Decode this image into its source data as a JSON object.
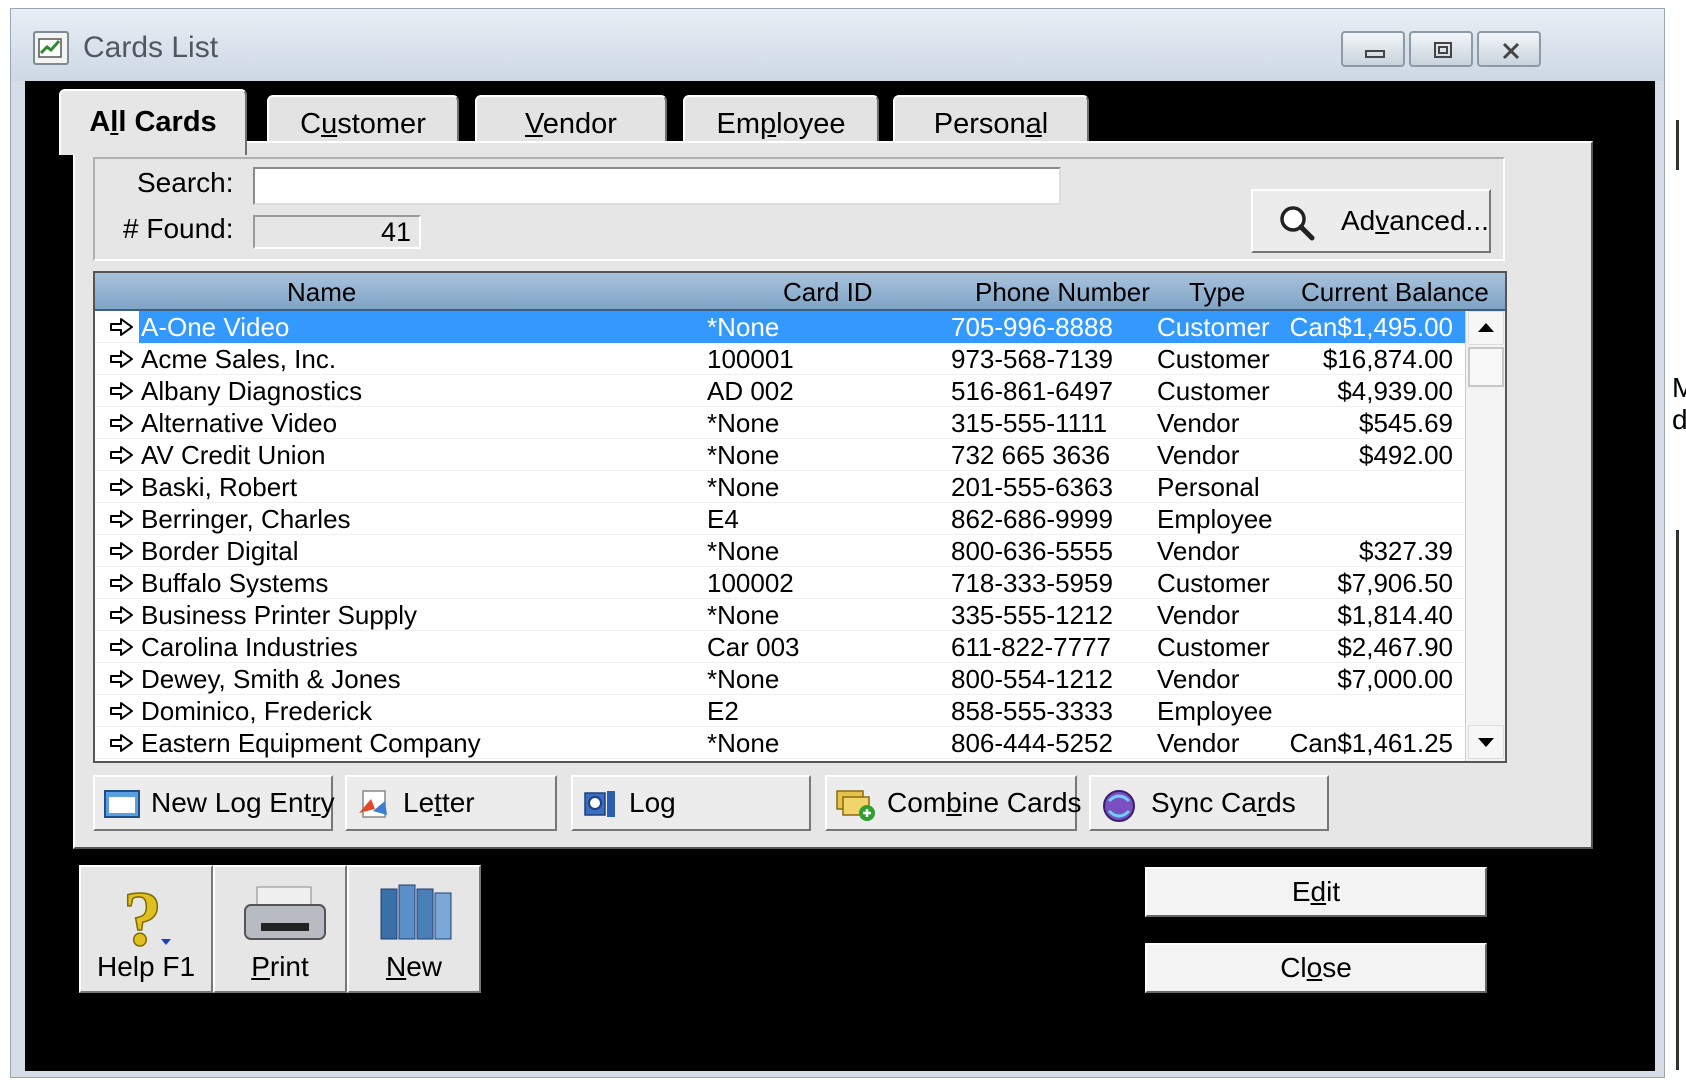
{
  "window": {
    "title": "Cards List"
  },
  "tabs": [
    {
      "label_pre": "A",
      "label_u": "l",
      "label_post": "l Cards",
      "active": true
    },
    {
      "label_pre": "C",
      "label_u": "u",
      "label_post": "stomer",
      "active": false
    },
    {
      "label_pre": "",
      "label_u": "V",
      "label_post": "endor",
      "active": false
    },
    {
      "label_pre": "Em",
      "label_u": "p",
      "label_post": "loyee",
      "active": false
    },
    {
      "label_pre": "Person",
      "label_u": "a",
      "label_post": "l",
      "active": false
    }
  ],
  "search": {
    "label": "Search:",
    "value": "",
    "found_label": "# Found:",
    "found_value": "41",
    "advanced_pre": "Ad",
    "advanced_u": "v",
    "advanced_post": "anced..."
  },
  "table": {
    "columns": [
      "Name",
      "Card ID",
      "Phone Number",
      "Type",
      "Current Balance"
    ],
    "rows": [
      {
        "name": "A-One Video",
        "card_id": "*None",
        "phone": "705-996-8888",
        "type": "Customer",
        "balance": "Can$1,495.00",
        "selected": true
      },
      {
        "name": "Acme Sales, Inc.",
        "card_id": "100001",
        "phone": "973-568-7139",
        "type": "Customer",
        "balance": "$16,874.00"
      },
      {
        "name": "Albany Diagnostics",
        "card_id": "AD 002",
        "phone": "516-861-6497",
        "type": "Customer",
        "balance": "$4,939.00"
      },
      {
        "name": "Alternative Video",
        "card_id": "*None",
        "phone": "315-555-1111",
        "type": "Vendor",
        "balance": "$545.69"
      },
      {
        "name": "AV Credit Union",
        "card_id": "*None",
        "phone": "732 665 3636",
        "type": "Vendor",
        "balance": "$492.00"
      },
      {
        "name": "Baski, Robert",
        "card_id": "*None",
        "phone": "201-555-6363",
        "type": "Personal",
        "balance": ""
      },
      {
        "name": "Berringer, Charles",
        "card_id": "E4",
        "phone": "862-686-9999",
        "type": "Employee",
        "balance": ""
      },
      {
        "name": "Border Digital",
        "card_id": "*None",
        "phone": "800-636-5555",
        "type": "Vendor",
        "balance": "$327.39"
      },
      {
        "name": "Buffalo Systems",
        "card_id": "100002",
        "phone": "718-333-5959",
        "type": "Customer",
        "balance": "$7,906.50"
      },
      {
        "name": "Business Printer Supply",
        "card_id": "*None",
        "phone": "335-555-1212",
        "type": "Vendor",
        "balance": "$1,814.40"
      },
      {
        "name": "Carolina Industries",
        "card_id": "Car 003",
        "phone": "611-822-7777",
        "type": "Customer",
        "balance": "$2,467.90"
      },
      {
        "name": "Dewey, Smith & Jones",
        "card_id": "*None",
        "phone": "800-554-1212",
        "type": "Vendor",
        "balance": "$7,000.00"
      },
      {
        "name": "Dominico, Frederick",
        "card_id": "E2",
        "phone": "858-555-3333",
        "type": "Employee",
        "balance": ""
      },
      {
        "name": "Eastern Equipment Company",
        "card_id": "*None",
        "phone": "806-444-5252",
        "type": "Vendor",
        "balance": "Can$1,461.25"
      }
    ]
  },
  "actions": {
    "new_log_entry_pre": "New Log Ent",
    "new_log_entry_u": "r",
    "new_log_entry_post": "y",
    "letter_pre": "Le",
    "letter_u": "t",
    "letter_post": "ter",
    "log": "Log",
    "combine_pre": "Com",
    "combine_u": "b",
    "combine_post": "ine Cards",
    "sync_pre": "Sync Ca",
    "sync_u": "r",
    "sync_post": "ds"
  },
  "bottom": {
    "help": "Help F1",
    "print_pre": "",
    "print_u": "P",
    "print_post": "rint",
    "new_pre": "",
    "new_u": "N",
    "new_post": "ew",
    "edit_pre": "E",
    "edit_u": "d",
    "edit_post": "it",
    "close_pre": "Cl",
    "close_u": "o",
    "close_post": "se"
  },
  "side_fragments": [
    "M",
    "d"
  ],
  "colors": {
    "selection": "#3399ff",
    "header": "#8fb0d0",
    "frame": "#000000"
  }
}
